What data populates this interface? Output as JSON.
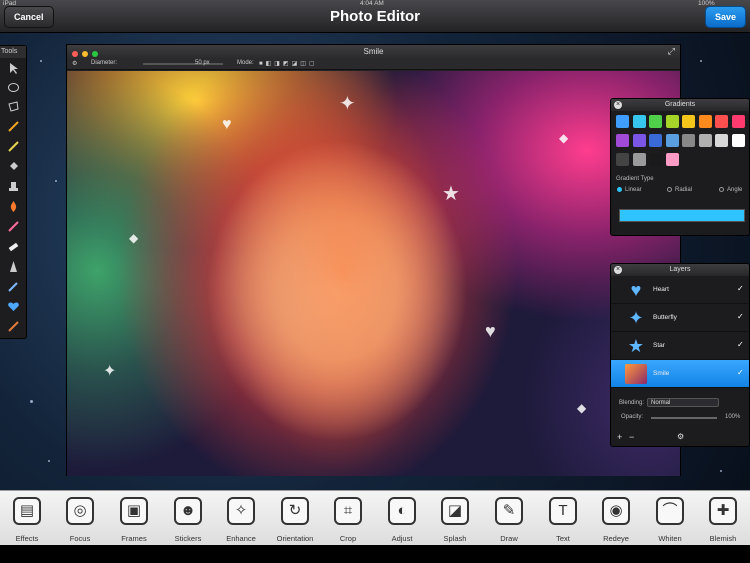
{
  "status": {
    "carrier": "iPad",
    "time": "4:04 AM",
    "battery": "100%"
  },
  "nav": {
    "title": "Photo Editor",
    "cancel_label": "Cancel",
    "save_label": "Save"
  },
  "tools": {
    "title": "Tools"
  },
  "document": {
    "title": "Smile",
    "diameter_label": "Diameter:",
    "diameter_value": "50 px",
    "mode_label": "Mode:"
  },
  "gradients": {
    "title": "Gradients",
    "type_label": "Gradient Type",
    "types": [
      "Linear",
      "Radial",
      "Angle"
    ],
    "selected_type": "Linear",
    "swatch_colors": [
      "#3f9dff",
      "#36c6ee",
      "#4fcf4a",
      "#a7d428",
      "#f5c51b",
      "#ff8a1e",
      "#ff4f4f",
      "#ff3a6e",
      "#a24ad8",
      "#7a55e6",
      "#3a6ad8",
      "#5a9ee0",
      "#888888",
      "#b0b0b0",
      "#d8d8d8",
      "#ffffff",
      "#444444",
      "#9a9a9a",
      "#1a1a1a",
      "#ff9cc6"
    ],
    "bar_color": "#2fc4ff"
  },
  "layers": {
    "title": "Layers",
    "items": [
      {
        "name": "Heart",
        "icon": "heart-icon"
      },
      {
        "name": "Butterfly",
        "icon": "butterfly-icon"
      },
      {
        "name": "Star",
        "icon": "star-icon"
      },
      {
        "name": "Smile",
        "icon": "photo-thumbnail"
      }
    ],
    "selected": "Smile",
    "blending_label": "Blending:",
    "blending_value": "Normal",
    "opacity_label": "Opacity:",
    "opacity_value": "100%"
  },
  "bottom_tools": [
    {
      "label": "Effects",
      "glyph": "▤"
    },
    {
      "label": "Focus",
      "glyph": "◎"
    },
    {
      "label": "Frames",
      "glyph": "▣"
    },
    {
      "label": "Stickers",
      "glyph": "☻"
    },
    {
      "label": "Enhance",
      "glyph": "✧"
    },
    {
      "label": "Orientation",
      "glyph": "↻"
    },
    {
      "label": "Crop",
      "glyph": "⌗"
    },
    {
      "label": "Adjust",
      "glyph": "◐"
    },
    {
      "label": "Splash",
      "glyph": "◪"
    },
    {
      "label": "Draw",
      "glyph": "✎"
    },
    {
      "label": "Text",
      "glyph": "T"
    },
    {
      "label": "Redeye",
      "glyph": "◉"
    },
    {
      "label": "Whiten",
      "glyph": "⌒"
    },
    {
      "label": "Blemish",
      "glyph": "✚"
    }
  ]
}
